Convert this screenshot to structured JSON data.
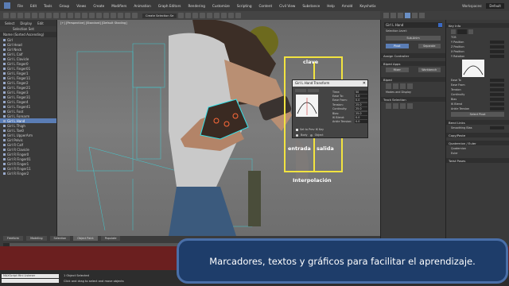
{
  "menubar": {
    "items": [
      "File",
      "Edit",
      "Tools",
      "Group",
      "Views",
      "Create",
      "Modifiers",
      "Animation",
      "Graph Editors",
      "Rendering",
      "Customize",
      "Scripting",
      "Content",
      "Civil View",
      "Substance",
      "Help",
      "Arnold",
      "Keyshotix"
    ],
    "workspaces_label": "Workspaces:",
    "workspace_value": "Default"
  },
  "toolbar": {
    "selection_set": "Create Selection Se"
  },
  "scene_explorer": {
    "tabs": [
      "Select",
      "Display",
      "Edit"
    ],
    "selection_set_label": "Selection Set:",
    "column_header": "Name (Sorted Ascending)",
    "rows": [
      "Girl",
      "Girl Head",
      "Girl Neck",
      "Girl L Calf",
      "Girl L Clavicle",
      "Girl L Finger0",
      "Girl L Finger01",
      "Girl L Finger1",
      "Girl L Finger11",
      "Girl L Finger2",
      "Girl L Finger21",
      "Girl L Finger3",
      "Girl L Finger31",
      "Girl L Finger4",
      "Girl L Finger41",
      "Girl L Foot",
      "Girl L Forearm",
      "Girl L Hand",
      "Girl L Thigh",
      "Girl L Toe0",
      "Girl L UpperArm",
      "Girl Pelvis",
      "Girl R Calf",
      "Girl R Clavicle",
      "Girl R Finger0",
      "Girl R Finger01",
      "Girl R Finger1",
      "Girl R Finger11",
      "Girl R Finger2"
    ],
    "highlight_index": 17
  },
  "viewport": {
    "label": "[+] [Perspective] [Standard] [Default Shading]"
  },
  "annotation": {
    "top": "clave",
    "left": "entrada",
    "right": "salida",
    "bottom": "Interpolación"
  },
  "float_window": {
    "title": "Girl L Hand Transform",
    "fields": [
      {
        "label": "Time:",
        "value": "50"
      },
      {
        "label": "Ease To:",
        "value": "0.0"
      },
      {
        "label": "Ease From:",
        "value": "0.0"
      },
      {
        "label": "Tension:",
        "value": "25.0"
      },
      {
        "label": "Continuity:",
        "value": "25.0"
      },
      {
        "label": "Bias:",
        "value": "25.0"
      },
      {
        "label": "IK Blend:",
        "value": "0.0"
      },
      {
        "label": "Ankle Tension:",
        "value": "0.0"
      }
    ],
    "check_label": "Set to Prev IK Key",
    "radio_body": "Body",
    "radio_object": "Object"
  },
  "rollout": {
    "title": "Girl L Hand",
    "selection_level": "Selection Level:",
    "buttons": [
      "Sub-Anim",
      "Separate",
      "Pivot"
    ],
    "sections": [
      "Assign Controller",
      "Biped Apps",
      "Biped",
      "Track Selection"
    ],
    "biped_apps_buttons": [
      "Mixer",
      "Workbench"
    ],
    "biped_extra": "Modes and Display"
  },
  "right_panel": {
    "key_info": "Key Info",
    "tcb": "TCB",
    "positions": [
      "Y Position",
      "Z Position",
      "X Position",
      "Y Rotation"
    ],
    "params": [
      "Ease To",
      "Ease From",
      "Tension",
      "Continuity",
      "Bias"
    ],
    "ik": [
      "IK Blend",
      "Ankle Tension"
    ],
    "ik_extra": "Select Pivot",
    "bend_links": "Bend Links",
    "smoothing_bias": "Smoothing Bias",
    "copy_paste": "Copy/Paste",
    "quaternion": "Quaternion / Euler",
    "quaternion_opt": "Quaternion",
    "euler_opt": "Euler",
    "twist_poses": "Twist Poses"
  },
  "workspace_tabs": [
    "Freeform",
    "Modeling",
    "Selection",
    "Object Paint",
    "Populate"
  ],
  "workspace_active_index": 3,
  "status": {
    "maxscript": "MAXScript Mini Listener",
    "line1": "1 Object Selected",
    "line2": "Click and drag to select and move objects"
  },
  "caption": "Marcadores, textos y gráficos para facilitar el aprendizaje."
}
